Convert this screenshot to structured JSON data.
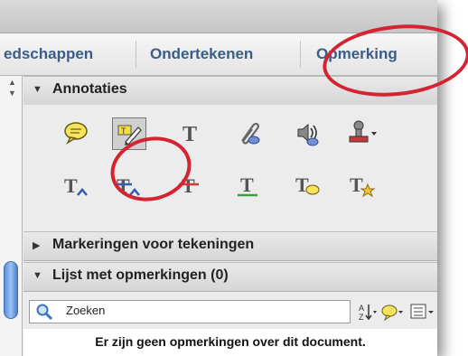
{
  "tabs": [
    {
      "label": "edschappen"
    },
    {
      "label": "Ondertekenen"
    },
    {
      "label": "Opmerking"
    }
  ],
  "sections": {
    "annotations": {
      "label": "Annotaties"
    },
    "drawing_markups": {
      "label": "Markeringen voor tekeningen"
    },
    "comments_list": {
      "label": "Lijst met opmerkingen (0)"
    }
  },
  "annotation_tools": [
    {
      "icon": "sticky-note-icon"
    },
    {
      "icon": "highlight-text-icon",
      "selected": true
    },
    {
      "icon": "add-text-icon"
    },
    {
      "icon": "attach-file-icon"
    },
    {
      "icon": "record-audio-icon"
    },
    {
      "icon": "stamp-icon"
    },
    {
      "icon": "insert-text-icon"
    },
    {
      "icon": "replace-text-icon"
    },
    {
      "icon": "strikethrough-icon"
    },
    {
      "icon": "underline-icon"
    },
    {
      "icon": "text-comment-icon"
    },
    {
      "icon": "text-star-icon"
    }
  ],
  "search": {
    "placeholder": "Zoeken"
  },
  "empty_message": "Er zijn geen opmerkingen over dit document.",
  "colors": {
    "tab_text": "#3b5d85",
    "highlight_red": "#d42431",
    "accent_blue": "#3a72c4"
  }
}
